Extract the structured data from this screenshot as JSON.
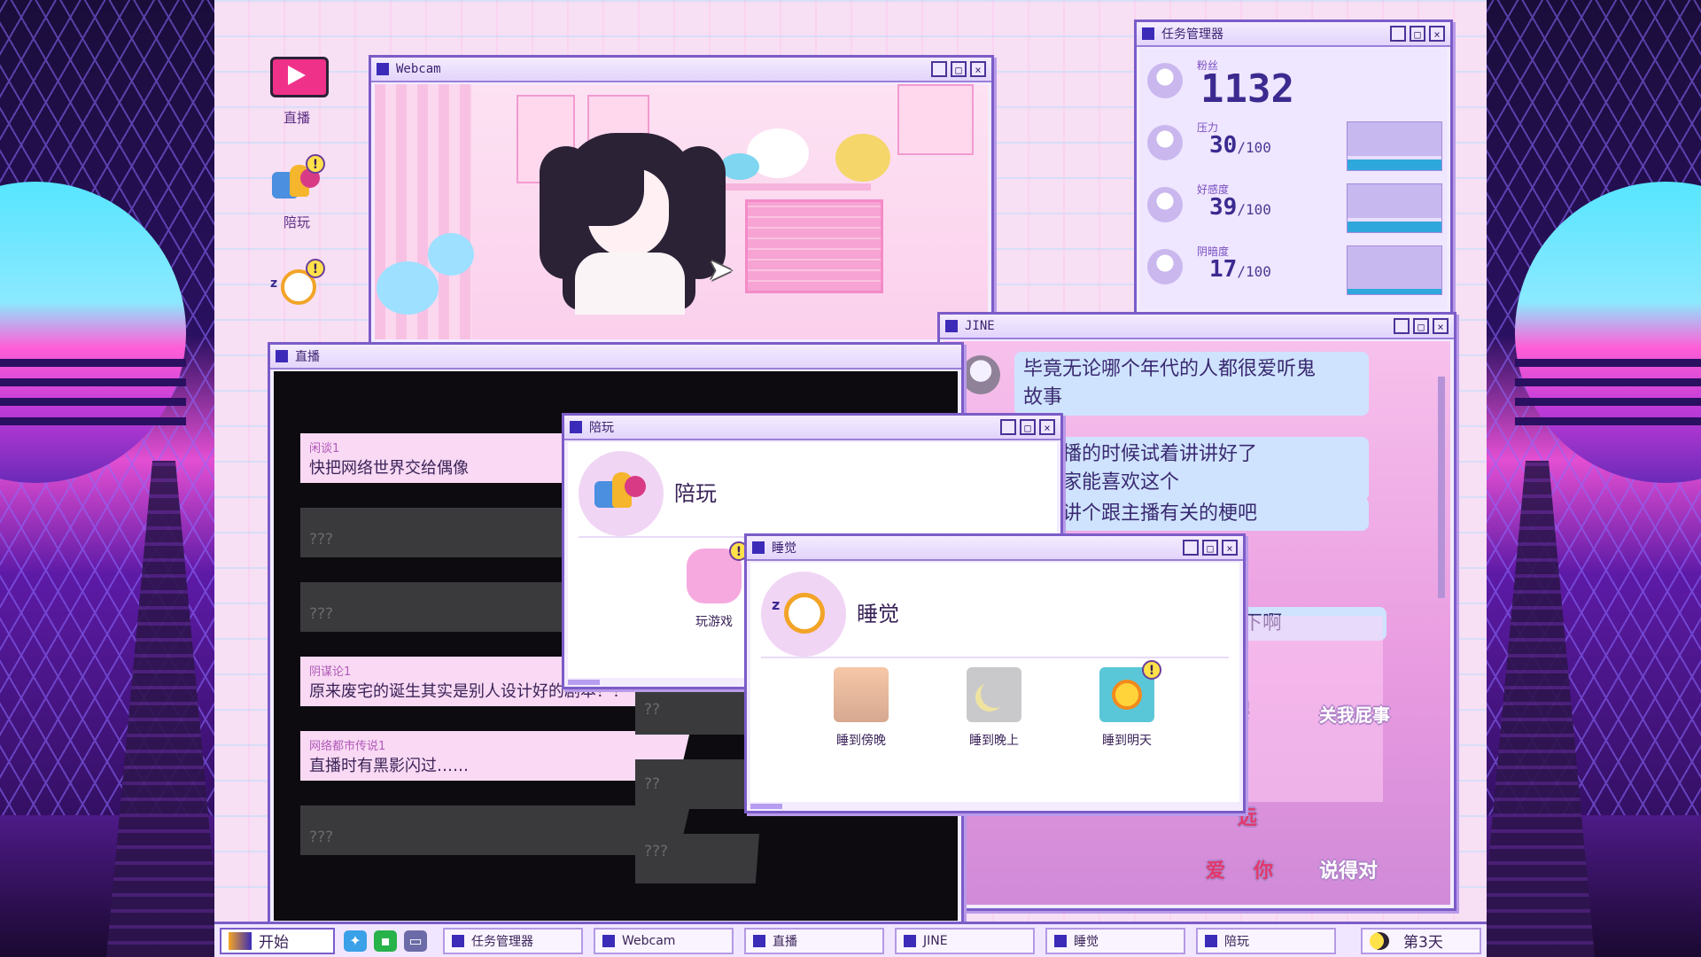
{
  "desktop_icons": [
    {
      "label": "直播"
    },
    {
      "label": "陪玩"
    },
    {
      "label": ""
    }
  ],
  "webcam": {
    "title": "Webcam"
  },
  "task_manager": {
    "title": "任务管理器",
    "stats": [
      {
        "name": "粉丝",
        "value": "1132",
        "max": ""
      },
      {
        "name": "压力",
        "value": "30",
        "max": "∕100",
        "level": 0.3
      },
      {
        "name": "好感度",
        "value": "39",
        "max": "∕100",
        "level": 0.39
      },
      {
        "name": "阴暗度",
        "value": "17",
        "max": "∕100",
        "level": 0.17
      }
    ]
  },
  "jine": {
    "title": "JINE",
    "messages": [
      "毕竟无论哪个年代的人都很爱听鬼",
      "故事",
      "在直播的时候试着讲讲好了",
      "望大家能喜欢这个",
      "次先讲个跟主播有关的梗吧",
      "能得到天下啊"
    ],
    "stamps": [
      "嘤嘤",
      "关我屁事",
      "远",
      "爱",
      "你",
      "说得对"
    ]
  },
  "livestream": {
    "title": "直播",
    "topics_left": [
      {
        "name": "闲谈1",
        "text": "快把网络世界交给偶像",
        "unlocked": true
      },
      {
        "name": "",
        "text": "???",
        "unlocked": false
      },
      {
        "name": "",
        "text": "???",
        "unlocked": false
      },
      {
        "name": "阴谋论1",
        "text": "原来废宅的诞生其实是别人设计好的剧本？！",
        "unlocked": true
      },
      {
        "name": "网络都市传说1",
        "text": "直播时有黑影闪过……",
        "unlocked": true
      },
      {
        "name": "",
        "text": "???",
        "unlocked": false
      }
    ],
    "topics_right": [
      "??",
      "??",
      "???"
    ]
  },
  "companion_dialog": {
    "title": "陪玩",
    "heading": "陪玩",
    "actions": [
      {
        "label": "玩游戏"
      }
    ]
  },
  "sleep_dialog": {
    "title": "睡觉",
    "heading": "睡觉",
    "actions": [
      {
        "label": "睡到傍晚"
      },
      {
        "label": "睡到晚上"
      },
      {
        "label": "睡到明天"
      }
    ]
  },
  "taskbar": {
    "start_label": "开始",
    "buttons": [
      "任务管理器",
      "Webcam",
      "直播",
      "JINE",
      "睡觉",
      "陪玩"
    ],
    "day_label": "第3天"
  },
  "window_buttons": {
    "minimize": "_",
    "maximize": "□",
    "close": "×"
  },
  "colors": {
    "accent": "#7b5cc8",
    "bar_fill": "#2ea7dd",
    "desktop_bg": "#f7dff4"
  }
}
